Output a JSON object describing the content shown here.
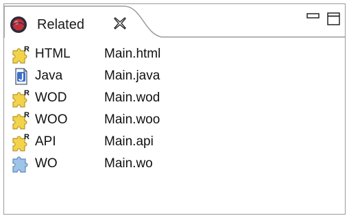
{
  "view": {
    "title": "Related",
    "icons": [
      "eclipse-icon",
      "close-icon",
      "minimize-icon",
      "maximize-icon"
    ]
  },
  "items": [
    {
      "label": "HTML",
      "file": "Main.html",
      "icon": "puzzle-r-icon"
    },
    {
      "label": "Java",
      "file": "Main.java",
      "icon": "java-file-icon"
    },
    {
      "label": "WOD",
      "file": "Main.wod",
      "icon": "puzzle-r-icon"
    },
    {
      "label": "WOO",
      "file": "Main.woo",
      "icon": "puzzle-r-icon"
    },
    {
      "label": "API",
      "file": "Main.api",
      "icon": "puzzle-r-icon"
    },
    {
      "label": "WO",
      "file": "Main.wo",
      "icon": "puzzle-blue-icon"
    }
  ],
  "colors": {
    "border": "#9a9a9a",
    "puzzle_yellow": "#f2d34a",
    "puzzle_blue": "#9ec4ea",
    "accent_red": "#c0303a"
  }
}
